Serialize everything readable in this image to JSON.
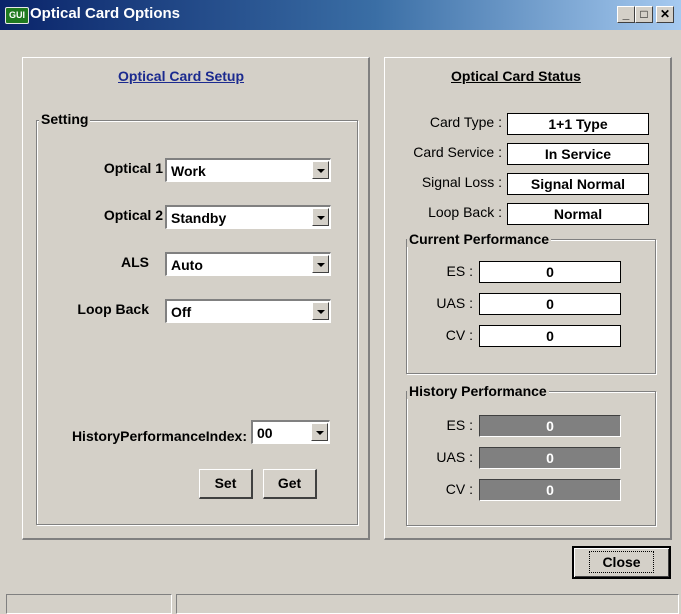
{
  "window": {
    "title": "Optical Card Options",
    "app_icon_text": "GUI",
    "minimize": "_",
    "maximize": "□",
    "close": "✕"
  },
  "setup": {
    "heading": "Optical Card Setup",
    "group_label": "Setting",
    "fields": [
      {
        "label": "Optical 1",
        "value": "Work"
      },
      {
        "label": "Optical 2",
        "value": "Standby"
      },
      {
        "label": "ALS",
        "value": "Auto"
      },
      {
        "label": "Loop Back",
        "value": "Off"
      }
    ],
    "history_index_label": "HistoryPerformanceIndex:",
    "history_index_value": "00",
    "set_label": "Set",
    "get_label": "Get"
  },
  "status": {
    "heading": "Optical Card Status",
    "rows": [
      {
        "label": "Card Type :",
        "value": "1+1 Type"
      },
      {
        "label": "Card Service :",
        "value": "In Service"
      },
      {
        "label": "Signal Loss :",
        "value": "Signal Normal"
      },
      {
        "label": "Loop Back :",
        "value": "Normal"
      }
    ],
    "current": {
      "label": "Current Performance",
      "rows": [
        {
          "label": "ES :",
          "value": "0"
        },
        {
          "label": "UAS :",
          "value": "0"
        },
        {
          "label": "CV :",
          "value": "0"
        }
      ]
    },
    "history": {
      "label": "History Performance",
      "rows": [
        {
          "label": "ES :",
          "value": "0"
        },
        {
          "label": "UAS :",
          "value": "0"
        },
        {
          "label": "CV :",
          "value": "0"
        }
      ]
    }
  },
  "close_label": "Close",
  "statusbar": {
    "pane1": "",
    "pane2": ""
  }
}
